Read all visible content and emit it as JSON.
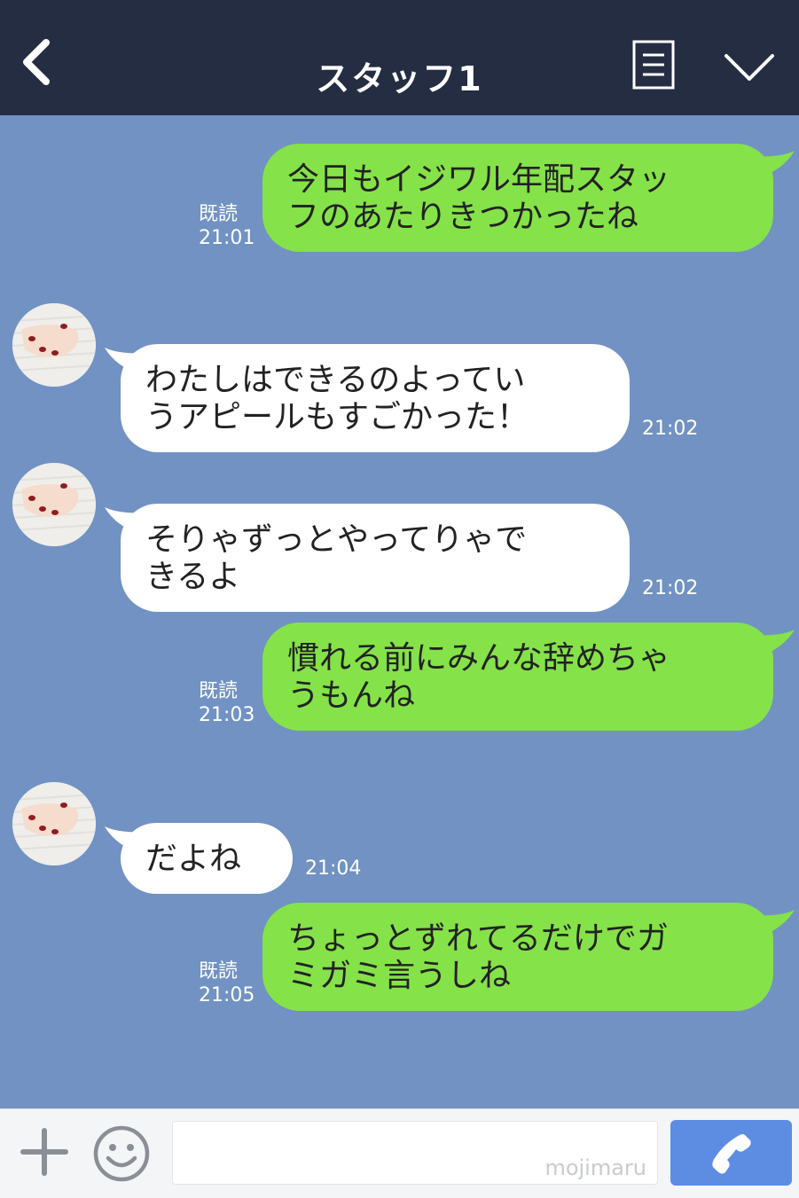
{
  "header": {
    "title": "スタッフ1"
  },
  "messages": [
    {
      "side": "me",
      "text": "今日もイジワル年配スタッ\nフのあたりきつかったね",
      "read_label": "既読",
      "time": "21:01"
    },
    {
      "side": "them",
      "text": "わたしはできるのよってい\nうアピールもすごかった！",
      "time": "21:02"
    },
    {
      "side": "them",
      "text": "そりゃずっとやってりゃで\nきるよ",
      "time": "21:02"
    },
    {
      "side": "me",
      "text": "慣れる前にみんな辞めちゃ\nうもんね",
      "read_label": "既読",
      "time": "21:03"
    },
    {
      "side": "them",
      "text": "だよね",
      "time": "21:04"
    },
    {
      "side": "me",
      "text": "ちょっとずれてるだけでガ\nミガミ言うしね",
      "read_label": "既読",
      "time": "21:05"
    }
  ],
  "footer": {
    "input_value": "",
    "watermark": "mojimaru"
  },
  "colors": {
    "header_bg": "#252d43",
    "chat_bg": "#7192c3",
    "my_bubble": "#85e249",
    "their_bubble": "#ffffff",
    "send_button": "#5d8de3"
  }
}
